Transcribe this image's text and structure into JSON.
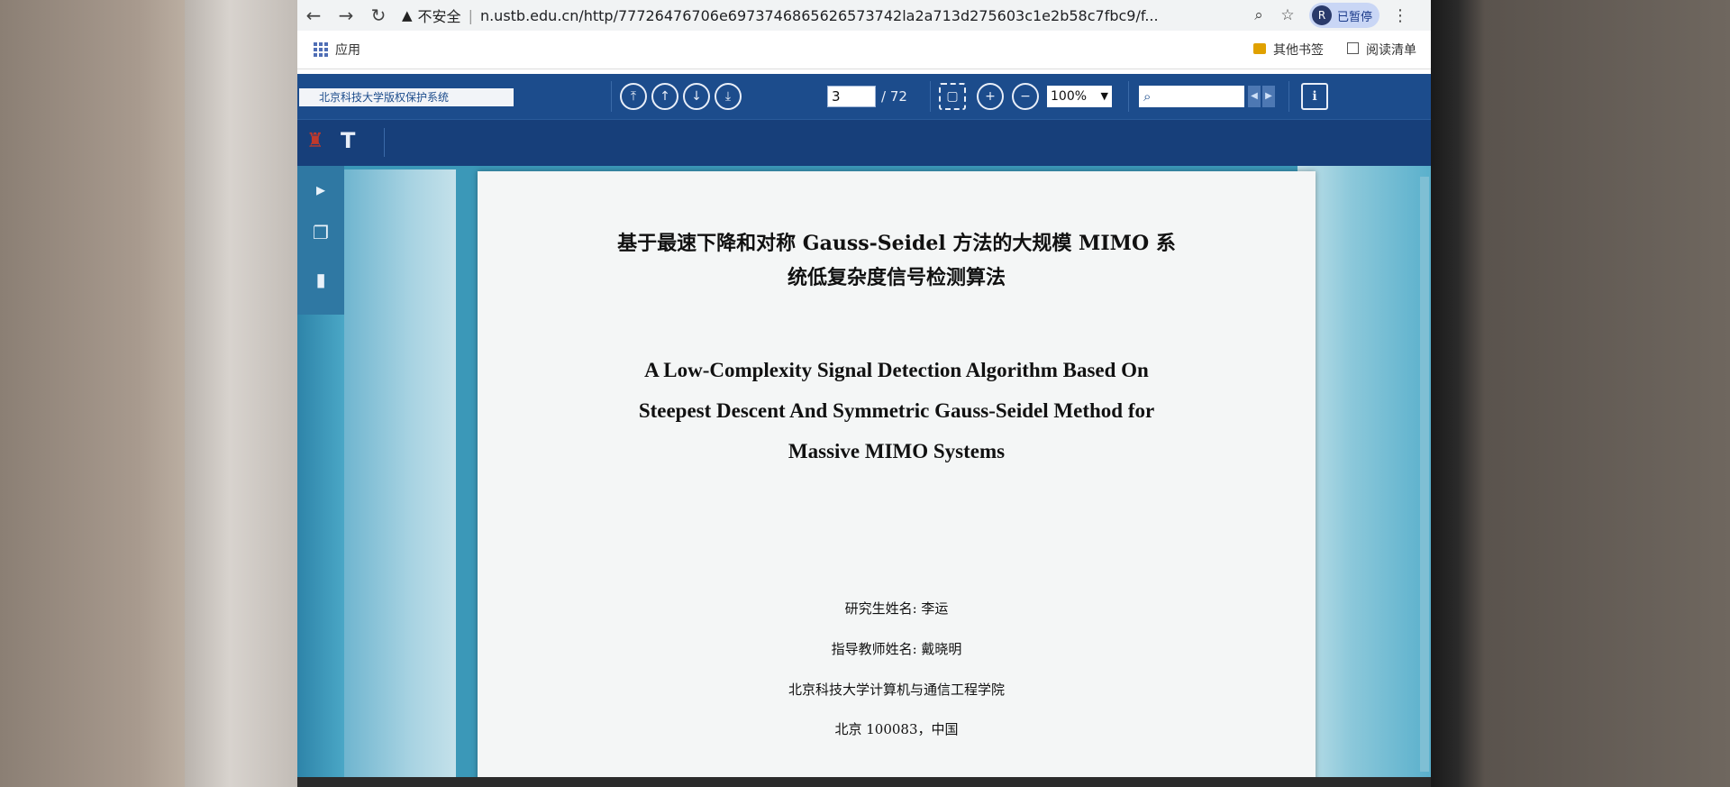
{
  "browser": {
    "url_warning": "不安全",
    "url": "n.ustb.edu.cn/http/77726476706e6973746865626573742la2a713d275603c1e2b58c7fbc9/f...",
    "profile_initial": "R",
    "profile_status": "已暂停"
  },
  "bookmarks": {
    "apps_label": "应用",
    "other_bookmarks": "其他书签",
    "reading_list": "阅读清单"
  },
  "viewer": {
    "system_label": "北京科技大学版权保护系统",
    "current_page": "3",
    "total_pages": "/ 72",
    "zoom": "100%"
  },
  "document": {
    "zh_title_line1": "基于最速下降和对称 Gauss-Seidel 方法的大规模 MIMO 系",
    "zh_title_line2": "统低复杂度信号检测算法",
    "en_title_line1": "A Low-Complexity Signal Detection Algorithm Based On",
    "en_title_line2": "Steepest Descent And Symmetric Gauss-Seidel Method for",
    "en_title_line3": "Massive MIMO Systems",
    "student": "研究生姓名: 李运",
    "advisor": "指导教师姓名: 戴晓明",
    "school": "北京科技大学计算机与通信工程学院",
    "address": "北京 100083，中国"
  },
  "icons": {
    "back": "arrow-left-icon",
    "forward": "arrow-right-icon",
    "reload": "reload-icon",
    "warning": "warning-triangle-icon",
    "zoom": "magnifier-icon",
    "star": "star-icon",
    "first_page": "first-page-icon",
    "prev_page": "arrow-up-circle-icon",
    "next_page": "arrow-down-circle-icon",
    "last_page": "last-page-icon",
    "fit_page": "fit-page-icon",
    "zoom_in": "plus-circle-icon",
    "zoom_out": "minus-circle-icon",
    "doc_info": "document-info-icon"
  },
  "colors": {
    "toolbar_blue": "#1c4c8c",
    "viewer_teal": "#3b98b8",
    "page_bg": "#f4f6f6"
  }
}
